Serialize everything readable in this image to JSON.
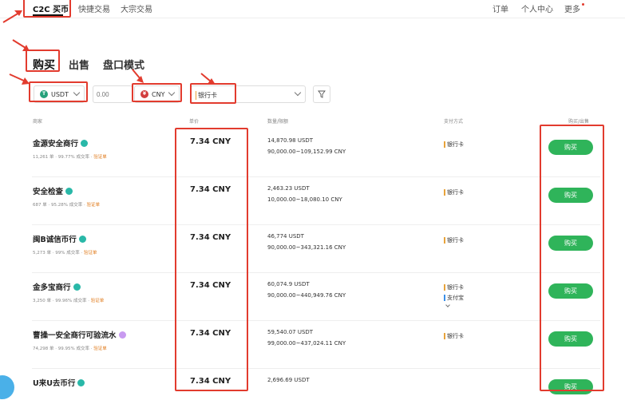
{
  "topnav": {
    "c2c": "C2C 买币",
    "quick": "快捷交易",
    "block": "大宗交易",
    "orders": "订单",
    "profile": "个人中心",
    "more": "更多"
  },
  "tabs": {
    "buy": "购买",
    "sell": "出售",
    "orderbook": "盘口模式"
  },
  "filters": {
    "coin": "USDT",
    "amount_placeholder": "0.00",
    "fiat": "CNY",
    "payment": "银行卡"
  },
  "columns": {
    "merchant": "商家",
    "price": "单价",
    "amount": "数量/限额",
    "payment": "支付方式",
    "action": "购买/出售"
  },
  "rows": [
    {
      "name": "金源安全商行",
      "orders": "11,261 单",
      "rate": "99.77% 成交率",
      "verify": "验证单",
      "price": "7.34 CNY",
      "amount": "14,870.98 USDT",
      "limit": "90,000.00~109,152.99 CNY",
      "payments": [
        "银行卡"
      ],
      "button": "购买"
    },
    {
      "name": "安全检查",
      "orders": "687 单",
      "rate": "95.28% 成交率",
      "verify": "验证单",
      "price": "7.34 CNY",
      "amount": "2,463.23 USDT",
      "limit": "10,000.00~18,080.10 CNY",
      "payments": [
        "银行卡"
      ],
      "button": "购买"
    },
    {
      "name": "闽B诚信币行",
      "orders": "5,273 单",
      "rate": "99% 成交率",
      "verify": "验证单",
      "price": "7.34 CNY",
      "amount": "46,774 USDT",
      "limit": "90,000.00~343,321.16 CNY",
      "payments": [
        "银行卡"
      ],
      "button": "购买"
    },
    {
      "name": "金多宝商行",
      "orders": "3,250 单",
      "rate": "99.96% 成交率",
      "verify": "验证单",
      "price": "7.34 CNY",
      "amount": "60,074.9 USDT",
      "limit": "90,000.00~440,949.76 CNY",
      "payments": [
        "银行卡",
        "支付宝"
      ],
      "button": "购买"
    },
    {
      "name": "曹操一安全商行可验流水",
      "orders": "74,298 单",
      "rate": "99.95% 成交率",
      "verify": "验证单",
      "price": "7.34 CNY",
      "amount": "59,540.07 USDT",
      "limit": "99,000.00~437,024.11 CNY",
      "payments": [
        "银行卡"
      ],
      "button": "购买"
    },
    {
      "name": "U来U去币行",
      "orders": "",
      "rate": "",
      "verify": "",
      "price": "7.34 CNY",
      "amount": "2,696.69 USDT",
      "limit": "",
      "payments": [],
      "button": "购买"
    }
  ],
  "colors": {
    "accent": "#2fb45a",
    "annotation": "#e23b2e",
    "verify": "#e07a1a"
  }
}
